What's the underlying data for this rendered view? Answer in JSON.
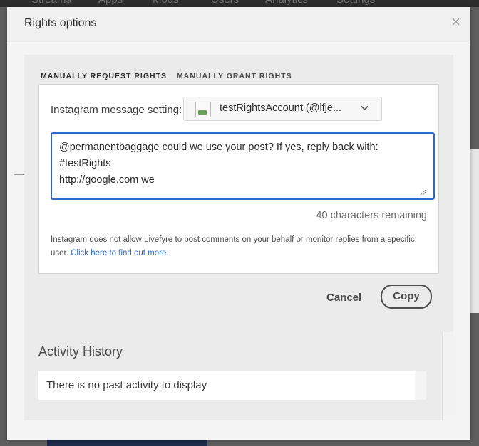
{
  "background_nav": [
    "Streams",
    "Apps",
    "Mods",
    "Users",
    "Analytics",
    "Settings"
  ],
  "modal": {
    "title": "Rights options",
    "close_glyph": "×"
  },
  "tabs": [
    {
      "label": "MANUALLY REQUEST RIGHTS",
      "active": true
    },
    {
      "label": "MANUALLY GRANT RIGHTS",
      "active": false
    }
  ],
  "form": {
    "message_setting_label": "Instagram message setting:",
    "account_selected": "testRightsAccount (@lfje...",
    "message_text": "@permanentbaggage could we use your post? If yes, reply back with:\n#testRights\nhttp://google.com we",
    "char_count": "40 characters remaining",
    "info_text": "Instagram does not allow Livefyre to post comments on your behalf or monitor replies from a specific user.",
    "info_link": "Click here to find out more."
  },
  "actions": {
    "cancel_label": "Cancel",
    "copy_label": "Copy"
  },
  "activity": {
    "title": "Activity History",
    "empty_text": "There is no past activity to display"
  },
  "colors": {
    "accent": "#2d68c4",
    "overlay": "#5d5d5d"
  },
  "icons": {
    "close": "close-icon",
    "account_avatar": "broken-image-icon",
    "dropdown": "chevron-down-icon"
  }
}
